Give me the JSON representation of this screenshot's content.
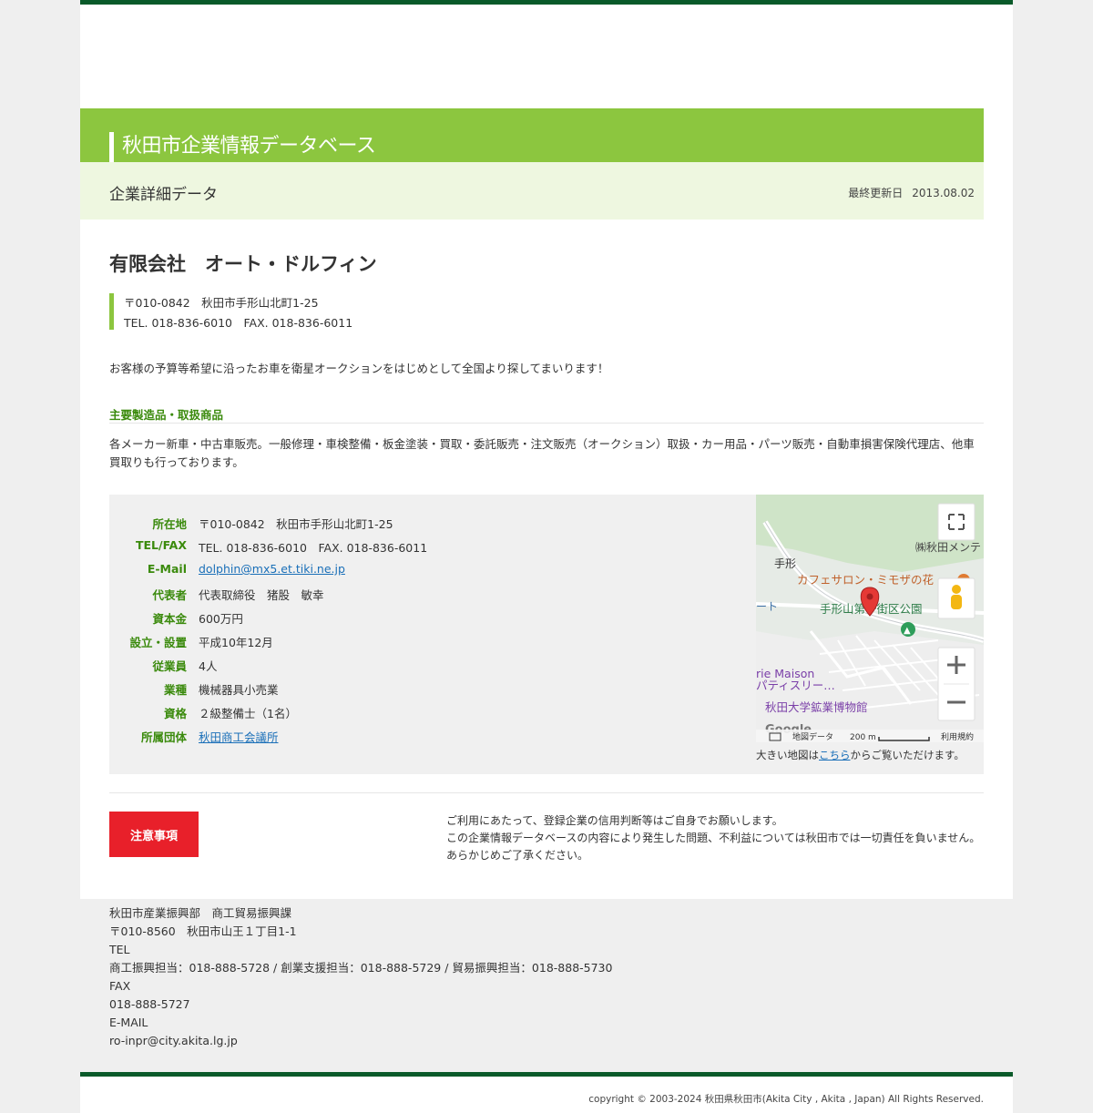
{
  "site": {
    "banner_title": "秋田市企業情報データベース",
    "section_label": "企業詳細データ",
    "updated_label": "最終更新日",
    "updated_date": "2013.08.02"
  },
  "company": {
    "name": "有限会社　オート・ドルフィン",
    "address_line": "〒010-0842　秋田市手形山北町1-25",
    "tel_fax_line": "TEL. 018-836-6010　FAX. 018-836-6011",
    "description": "お客様の予算等希望に沿ったお車を衛星オークションをはじめとして全国より探してまいります！",
    "products_heading": "主要製造品・取扱商品",
    "products_text": "各メーカー新車・中古車販売。一般修理・車検整備・板金塗装・買取・委託販売・注文販売（オークション）取扱・カー用品・パーツ販売・自動車損害保険代理店、他車買取りも行っております。"
  },
  "details": [
    {
      "key": "所在地",
      "value": "〒010-0842　秋田市手形山北町1-25"
    },
    {
      "key": "TEL/FAX",
      "value": "TEL. 018-836-6010　FAX. 018-836-6011"
    },
    {
      "key": "E-Mail",
      "value": "dolphin@mx5.et.tiki.ne.jp",
      "link": true
    },
    {
      "key": "代表者",
      "value": "代表取締役　猪股　敏幸"
    },
    {
      "key": "資本金",
      "value": "600万円"
    },
    {
      "key": "設立・設置",
      "value": "平成10年12月"
    },
    {
      "key": "従業員",
      "value": "4人"
    },
    {
      "key": "業種",
      "value": "機械器具小売業"
    },
    {
      "key": "資格",
      "value": "２級整備士（1名）"
    },
    {
      "key": "所属団体",
      "value": "秋田商工会議所",
      "link": true
    }
  ],
  "map": {
    "labels": {
      "tegata": "手形",
      "akita_men": "㈱秋田メンテ",
      "cafe": "カフェサロン・ミモザの花",
      "park": "手形山第一街区公園",
      "to": "ート",
      "maison1": "rie Maison",
      "maison2": "パティスリー…",
      "museum": "秋田大学鉱業博物館",
      "google": "Google",
      "map_data": "地図データ",
      "scale": "200 m",
      "terms": "利用規約"
    },
    "note_prefix": "大きい地図は",
    "note_link": "こちら",
    "note_suffix": "からご覧いただけます。"
  },
  "caution": {
    "button_label": "注意事項",
    "lines": [
      "ご利用にあたって、登録企業の信用判断等はご自身でお願いします。",
      "この企業情報データベースの内容により発生した問題、不利益については秋田市では一切責任を負いません。",
      "あらかじめご了承ください。"
    ]
  },
  "footer": {
    "lines": [
      "秋田市産業振興部　商工貿易振興課",
      "〒010-8560　秋田市山王１丁目1-1",
      "TEL",
      "商工振興担当：018-888-5728 / 創業支援担当：018-888-5729 / 貿易振興担当：018-888-5730",
      "FAX",
      "018-888-5727",
      "E-MAIL",
      "ro-inpr@city.akita.lg.jp"
    ],
    "copyright": "copyright © 2003-2024 秋田県秋田市(Akita City , Akita , Japan) All Rights Reserved."
  },
  "colors": {
    "brand_green": "#8cc63f",
    "dark_green": "#0a5a2a",
    "label_green": "#3a8a0c",
    "caution_red": "#e8202a",
    "link_blue": "#1a6fb8"
  }
}
